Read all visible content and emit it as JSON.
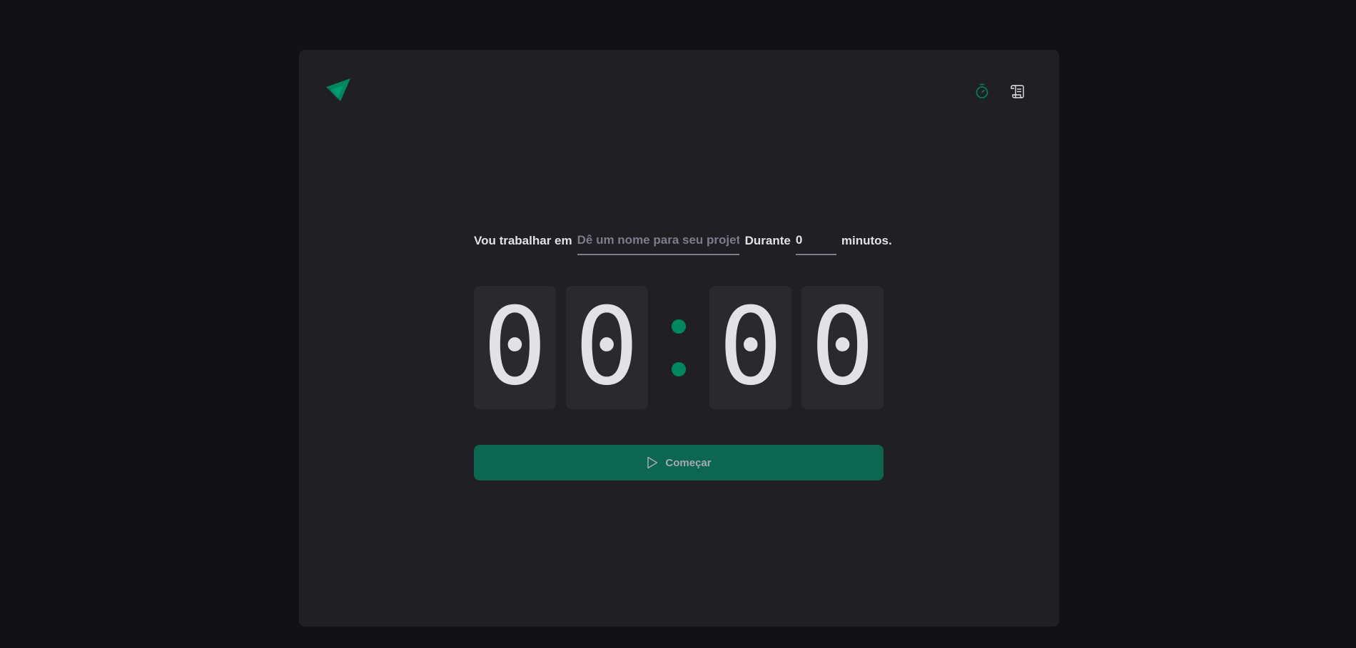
{
  "brand": {
    "accent": "#00875F",
    "accent_dark": "#0C6650",
    "background": "#121214",
    "card": "#202024",
    "digit_bg": "#29292E",
    "text": "#E1E1E6",
    "muted": "#7C7C8A"
  },
  "nav": {
    "items": [
      {
        "icon": "timer-icon",
        "active": true
      },
      {
        "icon": "scroll-icon",
        "active": false
      }
    ]
  },
  "form": {
    "task_label": "Vou trabalhar em",
    "task_placeholder": "Dê um nome para seu projeto",
    "task_value": "",
    "duration_label": "Durante",
    "minutes_value": "0",
    "minutes_suffix": "minutos."
  },
  "countdown": {
    "minutes_tens": "0",
    "minutes_ones": "0",
    "seconds_tens": "0",
    "seconds_ones": "0"
  },
  "start_button": {
    "label": "Começar",
    "icon": "play-icon"
  }
}
